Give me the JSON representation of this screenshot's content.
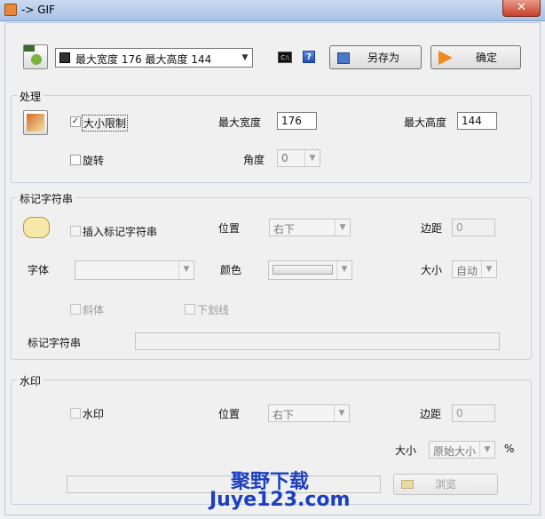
{
  "window": {
    "title": "-> GIF",
    "close_glyph": "✕"
  },
  "top": {
    "size_preset": "最大宽度 176 最大高度 144",
    "cmd_icon_text": "C:\\",
    "help_glyph": "?",
    "save_as_label": "另存为",
    "ok_label": "确定"
  },
  "process": {
    "title": "处理",
    "resize_label": "大小限制",
    "resize_checked": "✓",
    "max_width_label": "最大宽度",
    "max_width_value": "176",
    "max_height_label": "最大高度",
    "max_height_value": "144",
    "rotate_label": "旋转",
    "angle_label": "角度",
    "angle_value": "0"
  },
  "mark": {
    "title": "标记字符串",
    "insert_label": "插入标记字符串",
    "position_label": "位置",
    "position_value": "右下",
    "margin_label": "边距",
    "margin_value": "0",
    "font_label": "字体",
    "color_label": "颜色",
    "size_label": "大小",
    "size_value": "自动",
    "italic_label": "斜体",
    "underline_label": "下划线",
    "string_label": "标记字符串"
  },
  "watermark": {
    "title": "水印",
    "watermark_label": "水印",
    "position_label": "位置",
    "position_value": "右下",
    "margin_label": "边距",
    "margin_value": "0",
    "size_label": "大小",
    "size_value": "原始大小",
    "percent": "%",
    "browse_label": "浏览"
  },
  "site_watermark": {
    "line1": "聚野下载",
    "line2": "Juye123.com"
  }
}
